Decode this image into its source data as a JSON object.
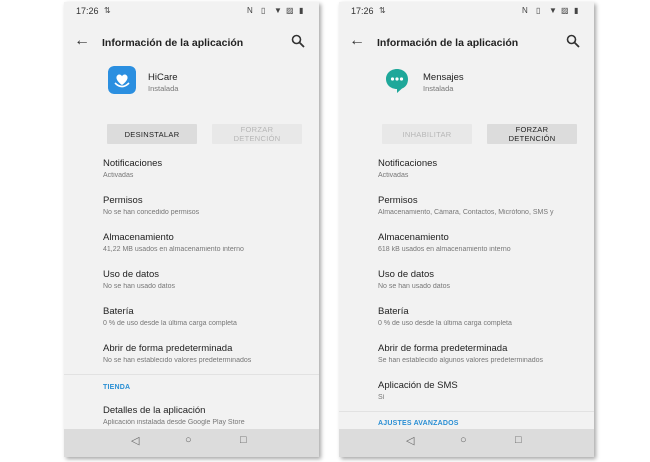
{
  "left": {
    "status": {
      "time": "17:26"
    },
    "appbar": {
      "title": "Información de la aplicación"
    },
    "app": {
      "name": "HiCare",
      "status": "Instalada"
    },
    "buttons": {
      "primary": "DESINSTALAR",
      "secondary_line1": "FORZAR",
      "secondary_line2": "DETENCIÓN"
    },
    "rows": [
      {
        "title": "Notificaciones",
        "subtitle": "Activadas"
      },
      {
        "title": "Permisos",
        "subtitle": "No se han concedido permisos"
      },
      {
        "title": "Almacenamiento",
        "subtitle": "41,22 MB usados en almacenamiento interno"
      },
      {
        "title": "Uso de datos",
        "subtitle": "No se han usado datos"
      },
      {
        "title": "Batería",
        "subtitle": "0 % de uso desde la última carga completa"
      },
      {
        "title": "Abrir de forma predeterminada",
        "subtitle": "No se han establecido valores predeterminados"
      }
    ],
    "section": "TIENDA",
    "store_row": {
      "title": "Detalles de la aplicación",
      "subtitle": "Aplicación instalada desde Google Play Store"
    }
  },
  "right": {
    "status": {
      "time": "17:26"
    },
    "appbar": {
      "title": "Información de la aplicación"
    },
    "app": {
      "name": "Mensajes",
      "status": "Instalada"
    },
    "buttons": {
      "primary": "INHABILITAR",
      "secondary_line1": "FORZAR",
      "secondary_line2": "DETENCIÓN"
    },
    "rows": [
      {
        "title": "Notificaciones",
        "subtitle": "Activadas"
      },
      {
        "title": "Permisos",
        "subtitle": "Almacenamiento, Cámara, Contactos, Micrófono, SMS y"
      },
      {
        "title": "Almacenamiento",
        "subtitle": "618 kB usados en almacenamiento interno"
      },
      {
        "title": "Uso de datos",
        "subtitle": "No se han usado datos"
      },
      {
        "title": "Batería",
        "subtitle": "0 % de uso desde la última carga completa"
      },
      {
        "title": "Abrir de forma predeterminada",
        "subtitle": "Se han establecido algunos valores predeterminados"
      },
      {
        "title": "Aplicación de SMS",
        "subtitle": "Sí"
      }
    ],
    "section": "AJUSTES AVANZADOS"
  },
  "icons": {
    "status_notification": "nfc-icon",
    "status_right": [
      "vibrate-icon",
      "wifi-icon",
      "no-sim-icon",
      "battery-icon"
    ],
    "nav": [
      "back-triangle-icon",
      "home-circle-icon",
      "recents-square-icon"
    ]
  },
  "colors": {
    "accent": "#2a8fd4",
    "hicare": "#2b8fe0",
    "mensajes": "#1fa89a"
  }
}
